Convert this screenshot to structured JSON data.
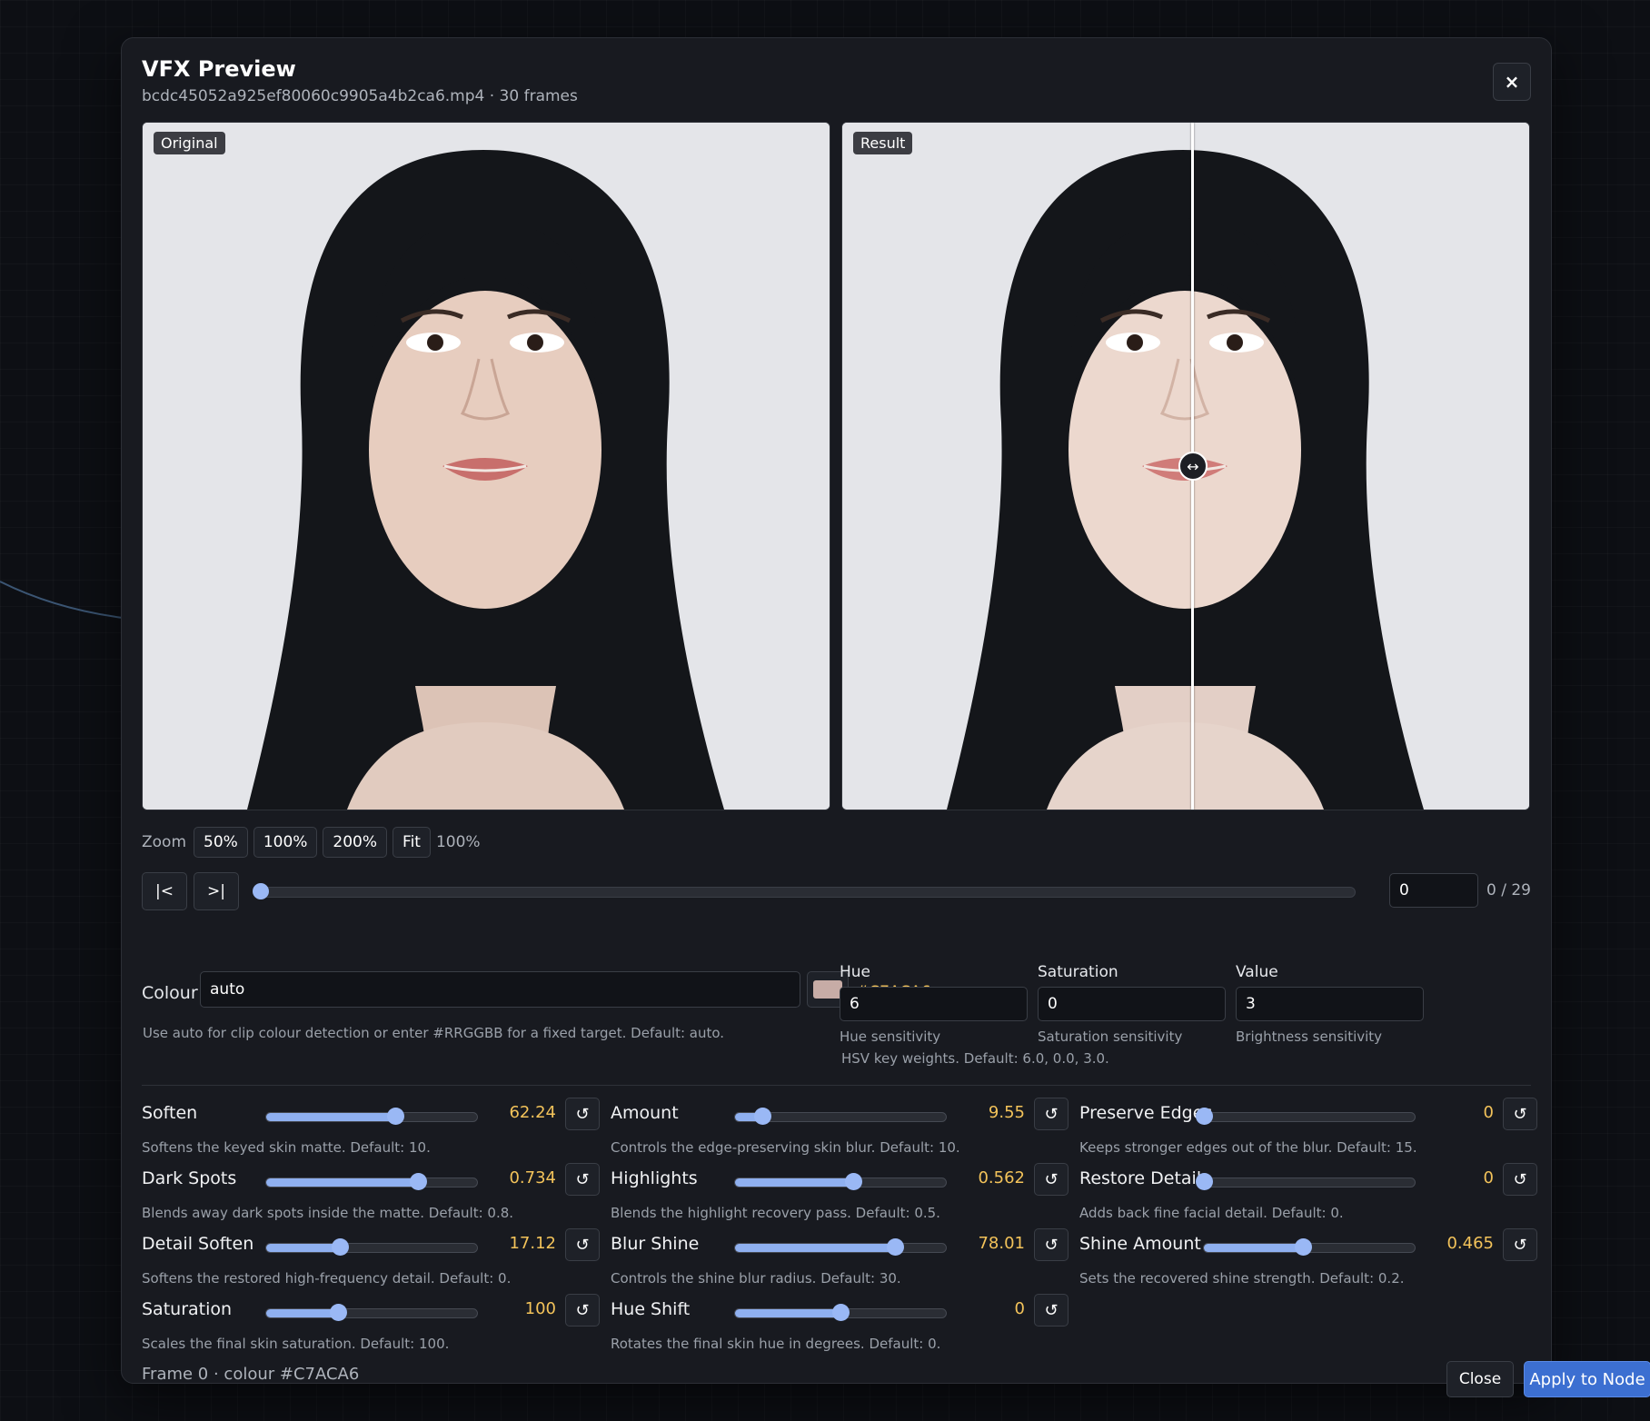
{
  "modal": {
    "title": "VFX Preview",
    "subtitle": "bcdc45052a925ef80060c9905a4b2ca6.mp4 · 30 frames",
    "close_icon": "×"
  },
  "panels": {
    "original_tag": "Original",
    "result_tag": "Result",
    "split_handle_icon": "↔"
  },
  "zoom": {
    "label": "Zoom",
    "options": [
      "50%",
      "100%",
      "200%",
      "Fit"
    ],
    "current": "100%"
  },
  "frame": {
    "first_label": "|<",
    "last_label": ">|",
    "value": "0",
    "count": "0 / 29",
    "position_fraction": 0
  },
  "colour": {
    "label": "Colour",
    "value": "auto",
    "hex": "#C7ACA6",
    "swatch_color": "#C7ACA6",
    "help": "Use auto for clip colour detection or enter #RRGGBB for a fixed target. Default: auto."
  },
  "hsv": {
    "hue": {
      "label": "Hue",
      "value": "6",
      "sub": "Hue sensitivity"
    },
    "saturation": {
      "label": "Saturation",
      "value": "0",
      "sub": "Saturation sensitivity"
    },
    "value": {
      "label": "Value",
      "value": "3",
      "sub": "Brightness sensitivity"
    },
    "help": "HSV key weights. Default: 6.0, 0.0, 3.0."
  },
  "params": [
    {
      "label": "Soften",
      "value": "62.24",
      "fraction": 0.61,
      "desc": "Softens the keyed skin matte. Default: 10."
    },
    {
      "label": "Amount",
      "value": "9.55",
      "fraction": 0.13,
      "desc": "Controls the edge-preserving skin blur. Default: 10."
    },
    {
      "label": "Preserve Edges",
      "value": "0",
      "fraction": 0.0,
      "desc": "Keeps stronger edges out of the blur. Default: 15."
    },
    {
      "label": "Dark Spots",
      "value": "0.734",
      "fraction": 0.72,
      "desc": "Blends away dark spots inside the matte. Default: 0.8."
    },
    {
      "label": "Highlights",
      "value": "0.562",
      "fraction": 0.56,
      "desc": "Blends the highlight recovery pass. Default: 0.5."
    },
    {
      "label": "Restore Detail",
      "value": "0",
      "fraction": 0.0,
      "desc": "Adds back fine facial detail. Default: 0."
    },
    {
      "label": "Detail Soften",
      "value": "17.12",
      "fraction": 0.35,
      "desc": "Softens the restored high-frequency detail. Default: 0."
    },
    {
      "label": "Blur Shine",
      "value": "78.01",
      "fraction": 0.76,
      "desc": "Controls the shine blur radius. Default: 30."
    },
    {
      "label": "Shine Amount",
      "value": "0.465",
      "fraction": 0.47,
      "desc": "Sets the recovered shine strength. Default: 0.2."
    },
    {
      "label": "Saturation",
      "value": "100",
      "fraction": 0.34,
      "desc": "Scales the final skin saturation. Default: 100."
    },
    {
      "label": "Hue Shift",
      "value": "0",
      "fraction": 0.5,
      "desc": "Rotates the final skin hue in degrees. Default: 0."
    }
  ],
  "reset_icon": "↺",
  "footer": {
    "status": "Frame 0 · colour #C7ACA6",
    "close_label": "Close",
    "apply_label": "Apply to Node"
  },
  "colors": {
    "accent": "#3c6fd1",
    "value_text": "#f3c35a",
    "slider": "#9ab8f5"
  }
}
